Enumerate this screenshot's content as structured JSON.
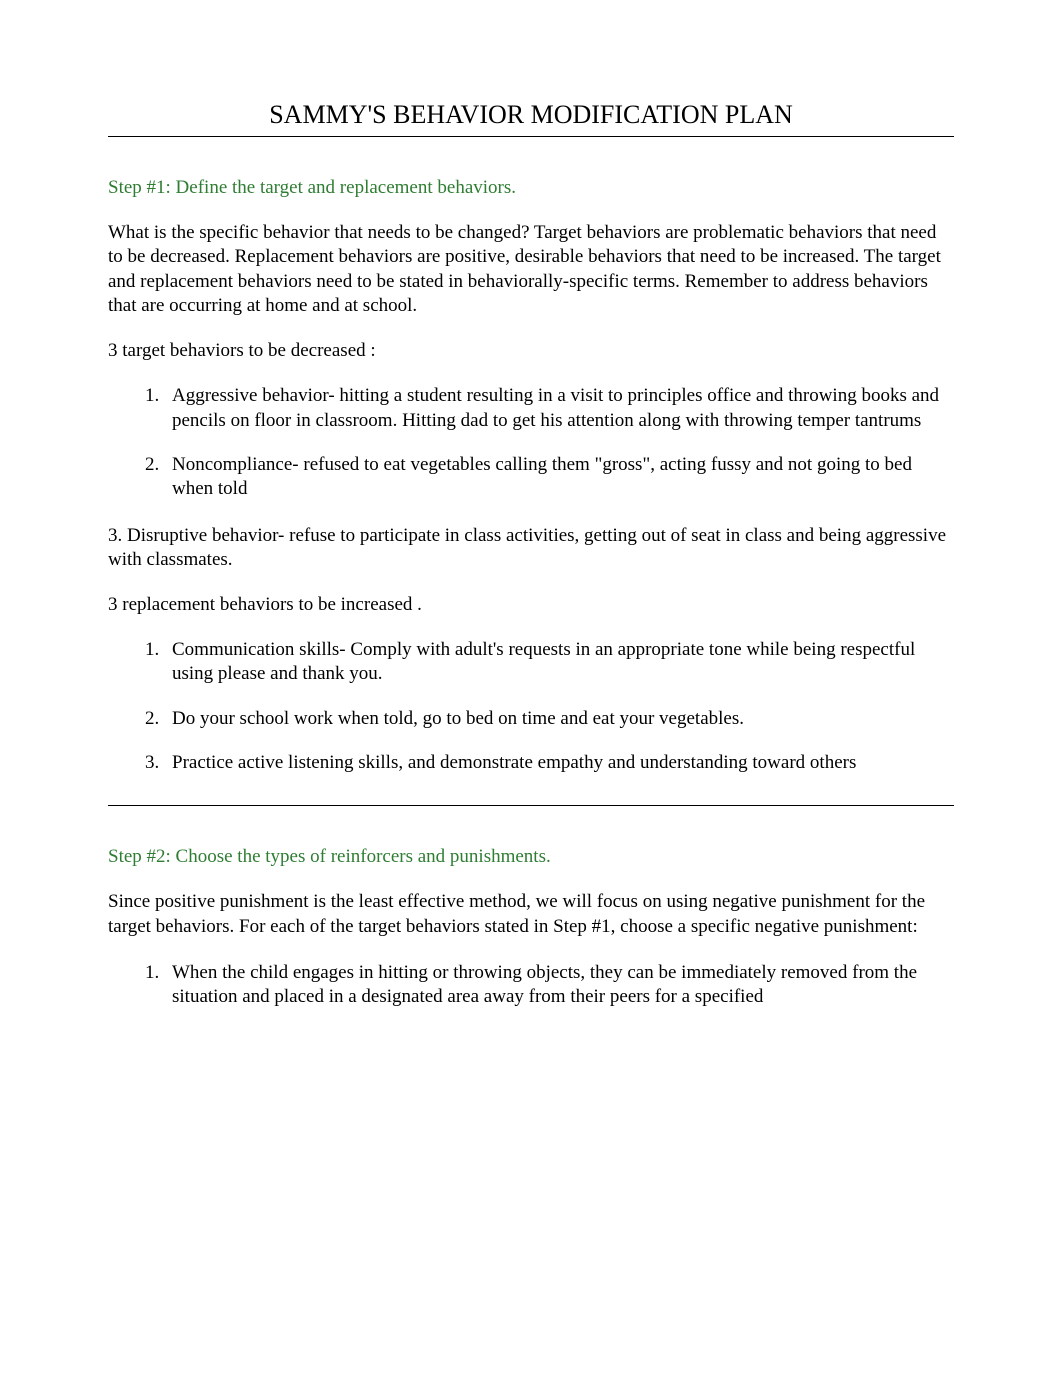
{
  "title": "SAMMY'S BEHAVIOR MODIFICATION PLAN",
  "step1": {
    "header": "Step #1:   Define the target and replacement behaviors.",
    "intro": "What is the specific behavior that needs to be changed?  Target behaviors are problematic behaviors that need to be decreased.  Replacement behaviors are positive, desirable behaviors that need to be increased.  The target and replacement behaviors need to be stated in behaviorally-specific terms.  Remember to address behaviors that are occurring at home and at school.",
    "target_label": "3 target behaviors to be decreased :",
    "target_items": [
      "Aggressive behavior- hitting a student resulting in a visit to principles office and throwing books and pencils on floor in classroom. Hitting dad to get his attention along with throwing temper tantrums",
      "Noncompliance- refused to eat vegetables calling them \"gross\", acting fussy and not going to bed when told"
    ],
    "target_item3": "3. Disruptive behavior- refuse to participate in class activities, getting out of seat in class and being aggressive with classmates.",
    "replacement_label": "3 replacement behaviors to be increased .",
    "replacement_items": [
      "Communication skills- Comply with adult's requests in an appropriate tone while being respectful using please and thank you.",
      "Do your school work when told, go to bed on time and eat your vegetables.",
      "Practice active listening skills, and demonstrate empathy and understanding toward others"
    ]
  },
  "step2": {
    "header": "Step #2:   Choose the types of reinforcers and punishments.",
    "intro": "Since positive punishment is the least effective method, we will focus on using negative punishment for the target behaviors.  For each of the target behaviors  stated in Step #1, choose a specific negative punishment:",
    "items": [
      "When the child engages in hitting or throwing objects, they can be immediately removed from the situation and placed in a designated area away from their peers for a specified"
    ]
  }
}
